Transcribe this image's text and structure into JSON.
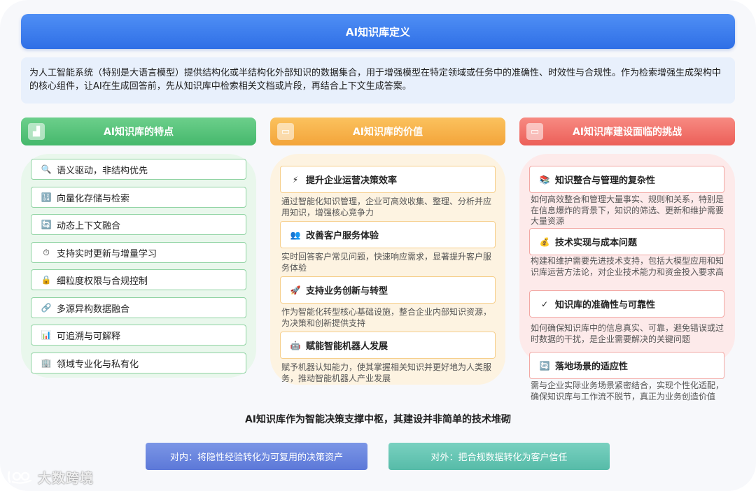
{
  "title": "AI知识库定义",
  "definition": "为人工智能系统（特别是大语言模型）提供结构化或半结构化外部知识的数据集合，用于增强模型在特定领域或任务中的准确性、时效性与合规性。作为检索增强生成架构中的核心组件，让AI在生成回答前，先从知识库中检索相关文档或片段，再结合上下文生成答案。",
  "columns": {
    "features_title": "AI知识库的特点",
    "value_title": "AI知识库的价值",
    "challenges_title": "AI知识库建设面临的挑战"
  },
  "features": [
    {
      "icon": "magnifier-icon",
      "glyph": "🔍",
      "label": "语义驱动，非结构优先"
    },
    {
      "icon": "vector-icon",
      "glyph": "🔢",
      "label": "向量化存储与检索"
    },
    {
      "icon": "refresh-icon",
      "glyph": "🔄",
      "label": "动态上下文融合"
    },
    {
      "icon": "stopwatch-icon",
      "glyph": "⏱",
      "label": "支持实时更新与增量学习"
    },
    {
      "icon": "lock-icon",
      "glyph": "🔒",
      "label": "细粒度权限与合规控制"
    },
    {
      "icon": "link-icon",
      "glyph": "🔗",
      "label": "多源异构数据融合"
    },
    {
      "icon": "bar-chart-icon",
      "glyph": "📊",
      "label": "可追溯与可解释"
    },
    {
      "icon": "building-icon",
      "glyph": "🏢",
      "label": "领域专业化与私有化"
    }
  ],
  "values": [
    {
      "icon": "lightning-icon",
      "glyph": "⚡",
      "title": "提升企业运营决策效率",
      "desc": "通过智能化知识管理，企业可高效收集、整理、分析并应用知识，增强核心竞争力"
    },
    {
      "icon": "people-icon",
      "glyph": "👥",
      "title": "改善客户服务体验",
      "desc": "实时回答客户常见问题，快速响应需求，显著提升客户服务体验"
    },
    {
      "icon": "rocket-icon",
      "glyph": "🚀",
      "title": "支持业务创新与转型",
      "desc": "作为智能化转型核心基础设施，整合企业内部知识资源，为决策和创新提供支持"
    },
    {
      "icon": "robot-icon",
      "glyph": "🤖",
      "title": "赋能智能机器人发展",
      "desc": "赋予机器认知能力，使其掌握相关知识并更好地为人类服务，推动智能机器人产业发展"
    }
  ],
  "challenges": [
    {
      "icon": "books-icon",
      "glyph": "📚",
      "title": "知识整合与管理的复杂性",
      "desc": "如何高效整合和管理大量事实、规则和关系，特别是在信息爆炸的背景下，知识的筛选、更新和维护需要大量资源"
    },
    {
      "icon": "money-bag-icon",
      "glyph": "💰",
      "title": "技术实现与成本问题",
      "desc": "构建和维护需要先进技术支持，包括大模型应用和知识库运营方法论，对企业技术能力和资金投入要求高"
    },
    {
      "icon": "check-icon",
      "glyph": "✓",
      "title": "知识库的准确性与可靠性",
      "desc": "如何确保知识库中的信息真实、可靠，避免错误或过时数据的干扰，是企业需要解决的关键问题"
    },
    {
      "icon": "refresh-icon",
      "glyph": "🔄",
      "title": "落地场景的适应性",
      "desc": "需与企业实际业务场景紧密结合，实现个性化适配，确保知识库与工作流不脱节，真正为业务创造价值"
    }
  ],
  "summary": "AI知识库作为智能决策支撑中枢，其建设并非简单的技术堆砌",
  "bottom": {
    "internal": "对内：将隐性经验转化为可复用的决策资产",
    "external": "对外：把合规数据转化为客户信任"
  },
  "watermark": "大数跨境"
}
